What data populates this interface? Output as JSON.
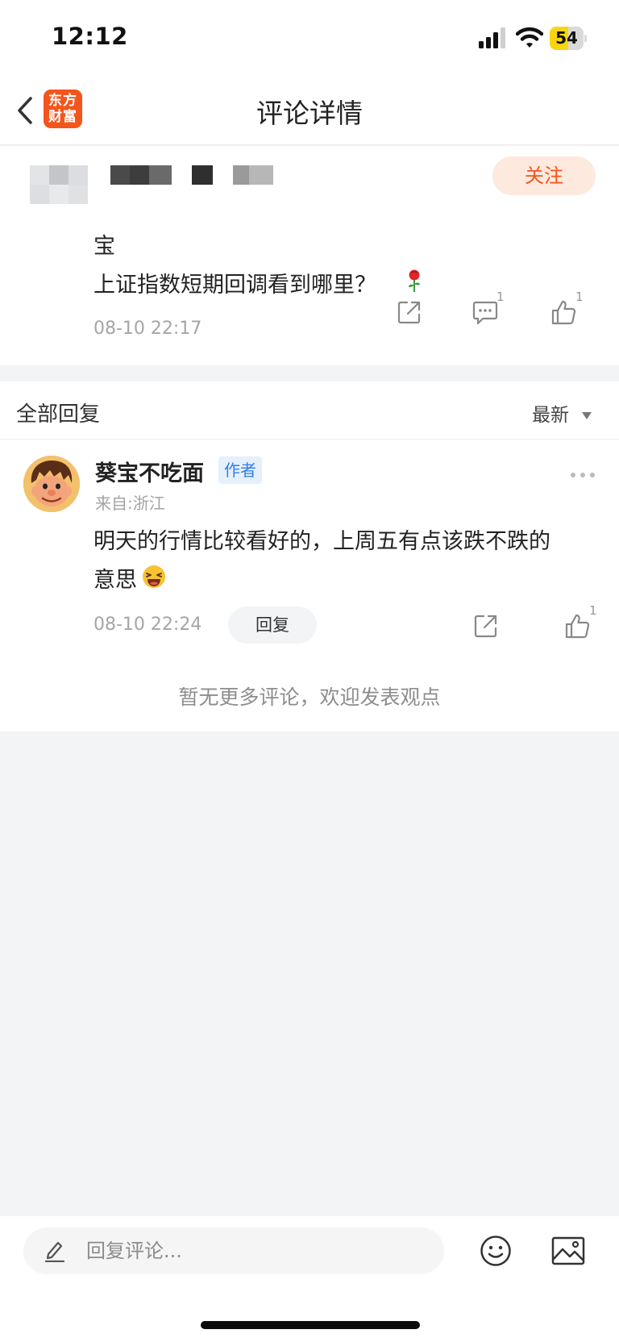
{
  "status_bar": {
    "time": "12:12",
    "battery_level": "54",
    "battery_fraction": 0.54,
    "battery_color": "#f9d511",
    "icons": [
      "cellular-signal-icon",
      "wifi-icon",
      "battery-icon"
    ]
  },
  "nav": {
    "title": "评论详情",
    "logo_text_line1": "东方",
    "logo_text_line2": "财富",
    "logo_color": "#f4551c"
  },
  "post": {
    "follow_label": "关注",
    "line1": "宝",
    "line2": "上证指数短期回调看到哪里？",
    "time": "08-10 22:17",
    "comment_count": "1",
    "like_count": "1",
    "icons": [
      "share-icon",
      "comment-icon",
      "thumbs-up-icon",
      "rose-emoji-icon"
    ]
  },
  "replies": {
    "title": "全部回复",
    "sort_label": "最新",
    "items": [
      {
        "name": "葵宝不吃面",
        "badge": "作者",
        "location": "来自:浙江",
        "line1": "明天的行情比较看好的，上周五有点该跌不跌的",
        "line2": "意思",
        "time": "08-10 22:24",
        "reply_label": "回复",
        "like_count": "1"
      }
    ],
    "no_more_text": "暂无更多评论，欢迎发表观点"
  },
  "bottom_bar": {
    "placeholder": "回复评论...",
    "icons": [
      "pencil-icon",
      "emoji-icon",
      "image-icon"
    ]
  },
  "colors": {
    "accent": "#f4551c",
    "follow_bg": "#fde9de",
    "badge_text": "#2f7ee5",
    "badge_bg": "#e6f0fc",
    "page_bg": "#f3f4f6"
  }
}
